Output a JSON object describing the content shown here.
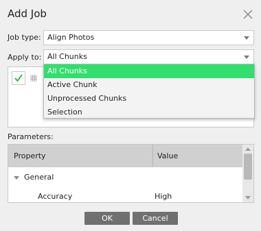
{
  "dialog": {
    "title": "Add Job",
    "close_icon": "close-icon"
  },
  "form": {
    "job_type_label": "Job type:",
    "job_type_value": "Align Photos",
    "apply_to_label": "Apply to:",
    "apply_to_value": "All Chunks"
  },
  "dropdown": {
    "options": [
      "All Chunks",
      "Active Chunk",
      "Unprocessed Chunks",
      "Selection"
    ],
    "selected": "All Chunks"
  },
  "parameters": {
    "label": "Parameters:",
    "columns": [
      "Property",
      "Value"
    ],
    "group": "General",
    "rows": [
      {
        "property": "Accuracy",
        "value": "High"
      }
    ]
  },
  "buttons": {
    "ok": "OK",
    "cancel": "Cancel"
  },
  "colors": {
    "selection": "#33dd6e",
    "check": "#2fbf4a",
    "button": "#707070"
  }
}
